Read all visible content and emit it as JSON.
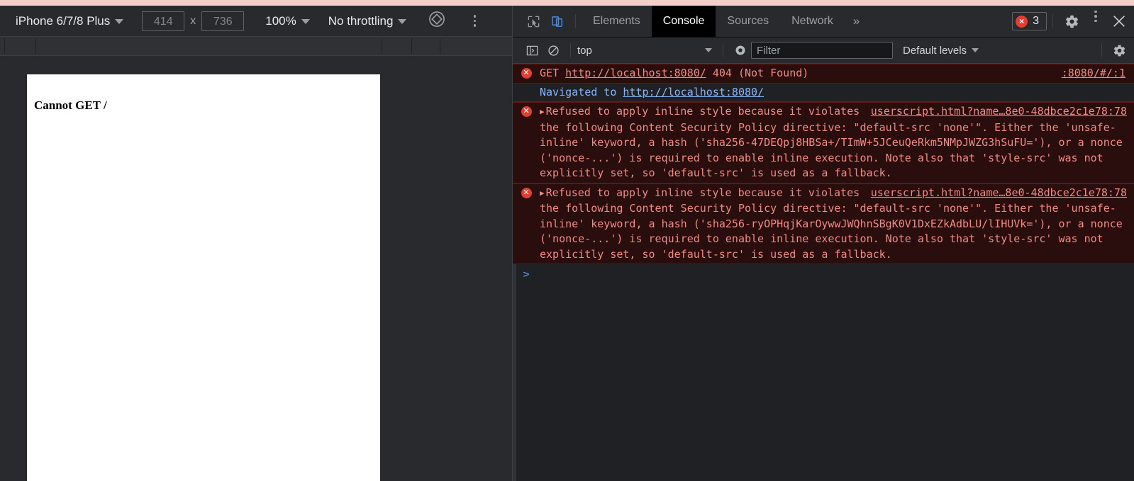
{
  "device_toolbar": {
    "device_name": "iPhone 6/7/8 Plus",
    "width_value": "414",
    "height_value": "736",
    "x_separator": "x",
    "zoom_value": "100%",
    "throttling_value": "No throttling",
    "rotate_icon": "rotate-device-icon",
    "more_options_icon": "more-options-icon"
  },
  "viewport": {
    "page_text": "Cannot GET /"
  },
  "devtools": {
    "inspect_icon": "inspect-element-icon",
    "device_toggle_icon": "toggle-device-toolbar-icon",
    "tabs": [
      {
        "label": "Elements",
        "active": false
      },
      {
        "label": "Console",
        "active": true
      },
      {
        "label": "Sources",
        "active": false
      },
      {
        "label": "Network",
        "active": false
      }
    ],
    "more_tabs_label": "»",
    "error_badge": {
      "icon_glyph": "×",
      "count": "3"
    },
    "settings_icon": "gear-icon",
    "main_menu_icon": "more-options-icon",
    "close_icon": "close-icon"
  },
  "console_toolbar": {
    "sidebar_toggle_icon": "console-sidebar-icon",
    "clear_icon": "clear-console-icon",
    "context_value": "top",
    "live_expression_icon": "eye-icon",
    "filter_placeholder": "Filter",
    "filter_value": "",
    "levels_value": "Default levels",
    "settings_icon": "gear-icon"
  },
  "console": {
    "messages": [
      {
        "type": "error",
        "collapsible": false,
        "prefix": "GET ",
        "link": "http://localhost:8080/",
        "suffix": " 404 (Not Found)",
        "source": ":8080/#/:1"
      },
      {
        "type": "info",
        "collapsible": false,
        "prefix": "Navigated to ",
        "link": "http://localhost:8080/",
        "suffix": "",
        "source": ""
      },
      {
        "type": "error",
        "collapsible": true,
        "prefix": "Refused to apply inline style ",
        "link": "",
        "suffix": "because it violates the following Content Security Policy directive: \"default-src 'none'\". Either the 'unsafe-inline' keyword, a hash ('sha256-47DEQpj8HBSa+/TImW+5JCeuQeRkm5NMpJWZG3hSuFU='), or a nonce ('nonce-...') is required to enable inline execution. Note also that 'style-src' was not explicitly set, so 'default-src' is used as a fallback.",
        "source": "userscript.html?name…8e0-48dbce2c1e78:78"
      },
      {
        "type": "error",
        "collapsible": true,
        "prefix": "Refused to apply inline style ",
        "link": "",
        "suffix": "because it violates the following Content Security Policy directive: \"default-src 'none'\". Either the 'unsafe-inline' keyword, a hash ('sha256-ryOPHqjKarOywwJWQhnSBgK0V1DxEZkAdbLU/lIHUVk='), or a nonce ('nonce-...') is required to enable inline execution. Note also that 'style-src' was not explicitly set, so 'default-src' is used as a fallback.",
        "source": "userscript.html?name…8e0-48dbce2c1e78:78"
      }
    ],
    "prompt_caret": ">",
    "prompt_value": ""
  },
  "colors": {
    "error_red": "#e33e30",
    "error_text": "#f08a84",
    "error_bg": "#2a0e0e",
    "link_blue": "#8ab4f8",
    "panel_bg": "#202124",
    "toolbar_bg": "#292a2d",
    "browser_strip": "#f2cfc8"
  }
}
